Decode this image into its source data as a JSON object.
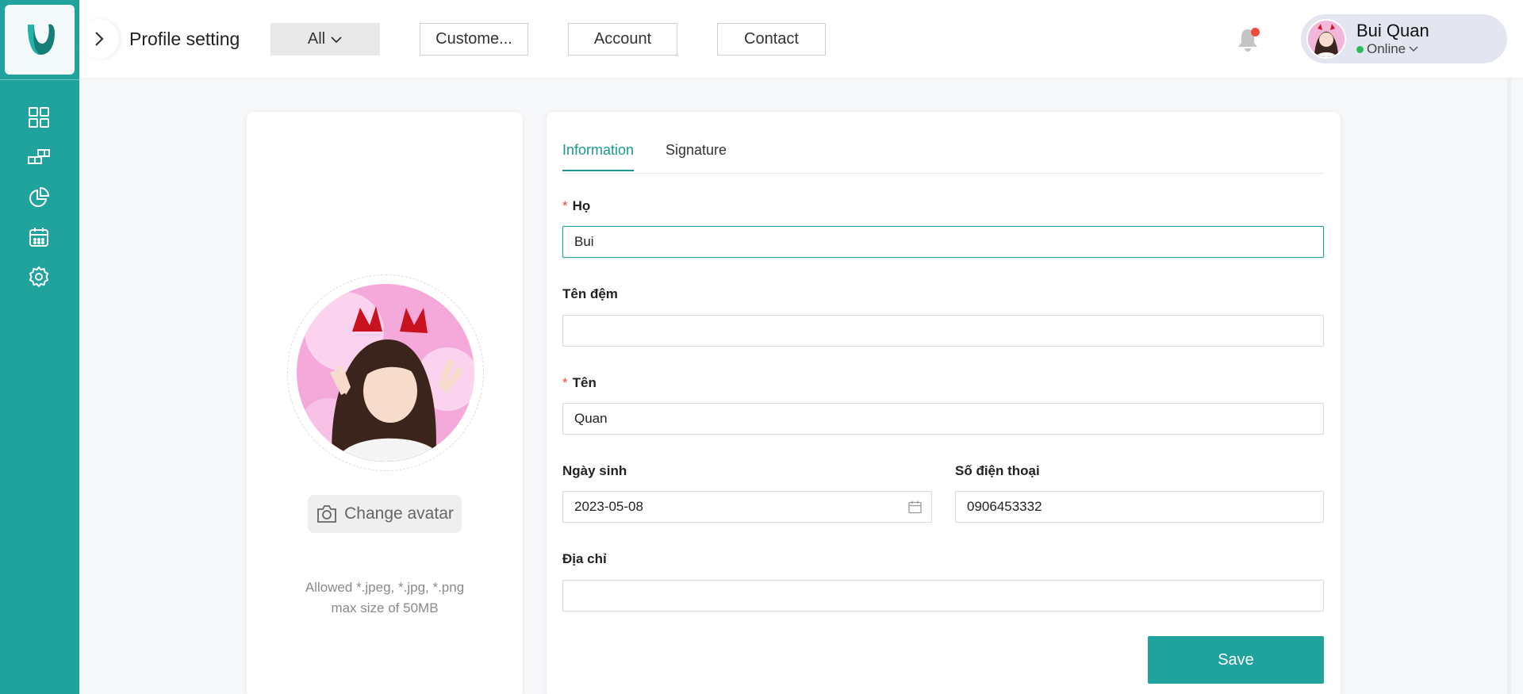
{
  "header": {
    "title": "Profile setting",
    "filters": [
      {
        "label": "All",
        "has_dropdown": true
      },
      {
        "label": "Custome..."
      },
      {
        "label": "Account"
      },
      {
        "label": "Contact"
      }
    ],
    "notification_has_badge": true,
    "user": {
      "name": "Bui Quan",
      "status": "Online"
    }
  },
  "sidebar": {
    "items": [
      {
        "icon": "dashboard-grid-icon"
      },
      {
        "icon": "blocks-icon"
      },
      {
        "icon": "pie-chart-icon"
      },
      {
        "icon": "calendar-icon"
      },
      {
        "icon": "gear-icon"
      }
    ]
  },
  "avatar_panel": {
    "change_avatar_label": "Change avatar",
    "hint_formats": "Allowed *.jpeg, *.jpg, *.png",
    "hint_size": "max size of 50MB"
  },
  "form": {
    "tabs": [
      {
        "label": "Information",
        "active": true
      },
      {
        "label": "Signature",
        "active": false
      }
    ],
    "fields": {
      "ho": {
        "label": "Họ",
        "required": true,
        "value": "Bui"
      },
      "ten_dem": {
        "label": "Tên đệm",
        "required": false,
        "value": ""
      },
      "ten": {
        "label": "Tên",
        "required": true,
        "value": "Quan"
      },
      "ngay_sinh": {
        "label": "Ngày sinh",
        "required": false,
        "value": "2023-05-08"
      },
      "so_dien_thoai": {
        "label": "Số điện thoại",
        "required": false,
        "value": "0906453332"
      },
      "dia_chi": {
        "label": "Địa chỉ",
        "required": false,
        "value": ""
      }
    },
    "save_label": "Save"
  },
  "colors": {
    "brand": "#1fa39c",
    "required_mark": "#e24a4a",
    "notification_dot": "#f2493b",
    "online_dot": "#2bbd5b"
  }
}
